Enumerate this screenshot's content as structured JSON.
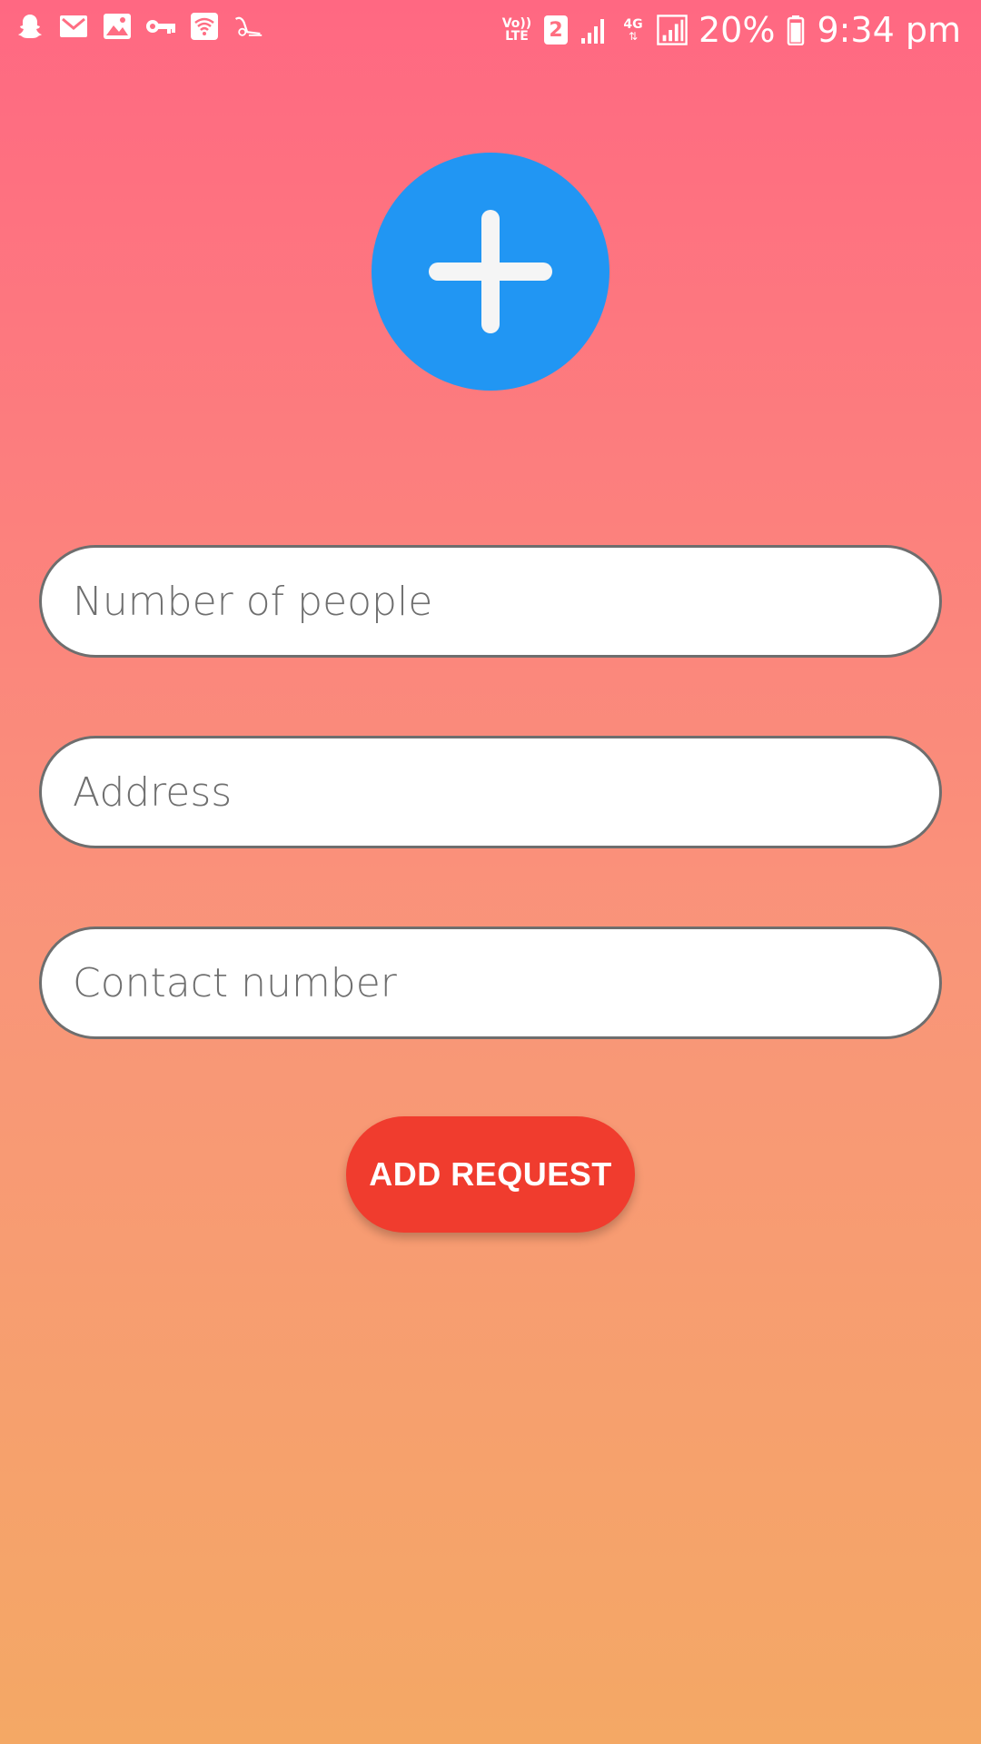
{
  "status_bar": {
    "left_icons": [
      "snapchat-icon",
      "gmail-icon",
      "gallery-icon",
      "key-icon",
      "wifi-hotspot-icon",
      "notification-app-icon"
    ],
    "volte_label": "Vo))\nLTE",
    "volte_top": "Vo))",
    "volte_bottom": "LTE",
    "sim_label": "2",
    "network_type": "4G",
    "battery_percent": "20%",
    "time": "9:34 pm"
  },
  "add_button": {
    "icon": "plus-icon",
    "color": "#2196f3"
  },
  "form": {
    "people": {
      "placeholder": "Number of people",
      "value": ""
    },
    "address": {
      "placeholder": "Address",
      "value": ""
    },
    "contact": {
      "placeholder": "Contact number",
      "value": ""
    }
  },
  "submit": {
    "label": "ADD REQUEST",
    "color": "#f03c2e"
  },
  "theme": {
    "gradient_top": "#ff6882",
    "gradient_bottom": "#f4a865"
  }
}
